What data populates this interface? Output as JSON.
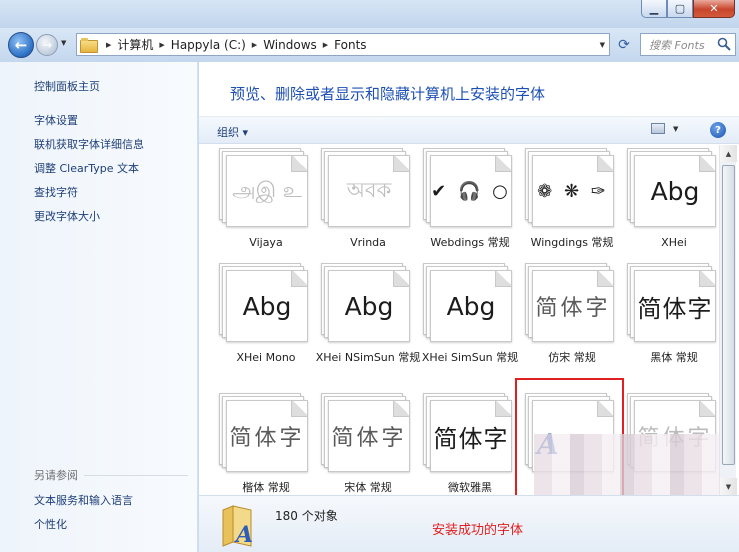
{
  "window": {
    "minimize": "▁",
    "maximize": "▢",
    "close": "✕"
  },
  "address_bar": {
    "crumbs": [
      "计算机",
      "Happyla (C:)",
      "Windows",
      "Fonts"
    ]
  },
  "search": {
    "placeholder": "搜索 Fonts"
  },
  "left_pane": {
    "links": [
      "控制面板主页",
      "字体设置",
      "联机获取字体详细信息",
      "调整 ClearType 文本",
      "查找字符",
      "更改字体大小"
    ],
    "see_also_title": "另请参阅",
    "see_also_links": [
      "文本服务和输入语言",
      "个性化"
    ]
  },
  "main": {
    "headline": "预览、删除或者显示和隐藏计算机上安装的字体",
    "organize": "组织",
    "help": "?"
  },
  "fonts": [
    {
      "sample": "அஇ உ",
      "label": "Vijaya"
    },
    {
      "sample": "অবক",
      "label": "Vrinda"
    },
    {
      "sample": "✔ 🎧 ○",
      "label": "Webdings 常规"
    },
    {
      "sample": "❁ ❋ ✑",
      "label": "Wingdings 常规"
    },
    {
      "sample": "Abg",
      "label": "XHei"
    },
    {
      "sample": "Abg",
      "label": "XHei Mono"
    },
    {
      "sample": "Abg",
      "label": "XHei NSimSun 常规"
    },
    {
      "sample": "Abg",
      "label": "XHei SimSun 常规"
    },
    {
      "sample": "简体字",
      "label": "仿宋 常规"
    },
    {
      "sample": "简体字",
      "label": "黑体 常规"
    },
    {
      "sample": "简体字",
      "label": "楷体 常规"
    },
    {
      "sample": "简体字",
      "label": "宋体 常规"
    },
    {
      "sample": "简体字",
      "label": "微软雅黑"
    },
    {
      "sample": "A",
      "label": ""
    },
    {
      "sample": "简体字",
      "label": ""
    }
  ],
  "status": {
    "count": "180 个对象",
    "annotation": "安装成功的字体"
  },
  "colors": {
    "accent": "#1e50b4",
    "highlight": "#e02020"
  }
}
